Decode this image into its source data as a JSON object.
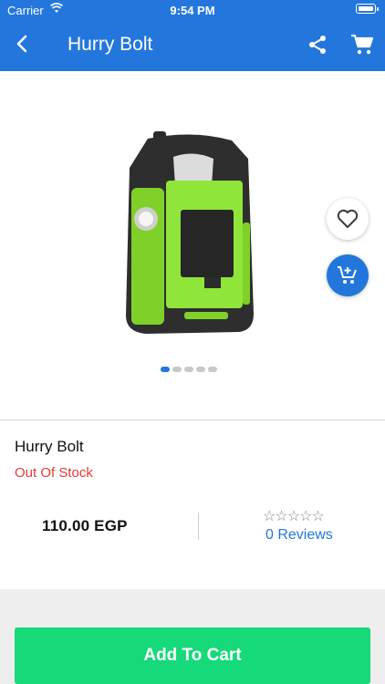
{
  "status_bar": {
    "carrier": "Carrier",
    "time": "9:54 PM"
  },
  "navbar": {
    "title": "Hurry Bolt"
  },
  "gallery": {
    "dots": 5,
    "active_index": 0
  },
  "product": {
    "name": "Hurry Bolt",
    "stock_status": "Out Of Stock",
    "price": "110.00  EGP",
    "rating_stars": "☆☆☆☆☆",
    "reviews": "0  Reviews"
  },
  "actions": {
    "add_to_cart_label": "Add To Cart"
  },
  "colors": {
    "primary": "#2377dc",
    "cta": "#16d97a",
    "stock_out": "#e53935"
  },
  "icons": [
    "back-arrow-icon",
    "share-icon",
    "cart-icon",
    "heart-icon",
    "add-cart-icon",
    "wifi-icon",
    "battery-icon"
  ]
}
